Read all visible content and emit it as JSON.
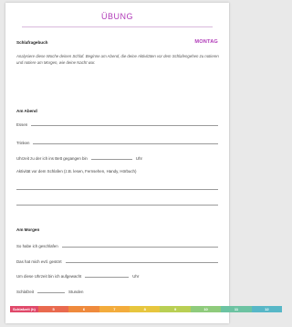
{
  "header": {
    "title": "ÜBUNG",
    "left_label": "Schlafragebuch",
    "day": "MONTAG"
  },
  "intro": "Analysiere diese Woche deinen Schlaf. Beginne am Abend, die deine Aktivitäten vor dem Schlafengehen zu notieren und notiere am Morgen, wie deine Nacht war.",
  "evening": {
    "heading": "Am Abend",
    "eat": "Essen",
    "drink": "Trinken",
    "bedtime": "Uhrzeit zu der ich ins Bett gegangen bin",
    "bedtime_unit": "Uhr",
    "activity": "Aktivität vor dem Schlafen (z.B. lesen, Fernsehen, Handy, Hörbuch)"
  },
  "morning": {
    "heading": "Am Morgen",
    "slept": "So habe ich geschlafen",
    "disturbed": "Das hat mich evtl. gestört",
    "wakeup": "Um diese Uhrzeit bin ich aufgewacht",
    "wakeup_unit": "Uhr",
    "sleeptime": "Schlafzeit",
    "sleeptime_unit": "Stunden"
  },
  "scale": {
    "caption": "Schlafzeit (h)",
    "values": [
      "5",
      "6",
      "7",
      "8",
      "9",
      "10",
      "11",
      "12"
    ],
    "colors": [
      "#e96a4f",
      "#ef8a3d",
      "#f3ac3c",
      "#e7c63e",
      "#b9cf54",
      "#8fcb7c",
      "#6cc3a2",
      "#57b7c7"
    ]
  }
}
